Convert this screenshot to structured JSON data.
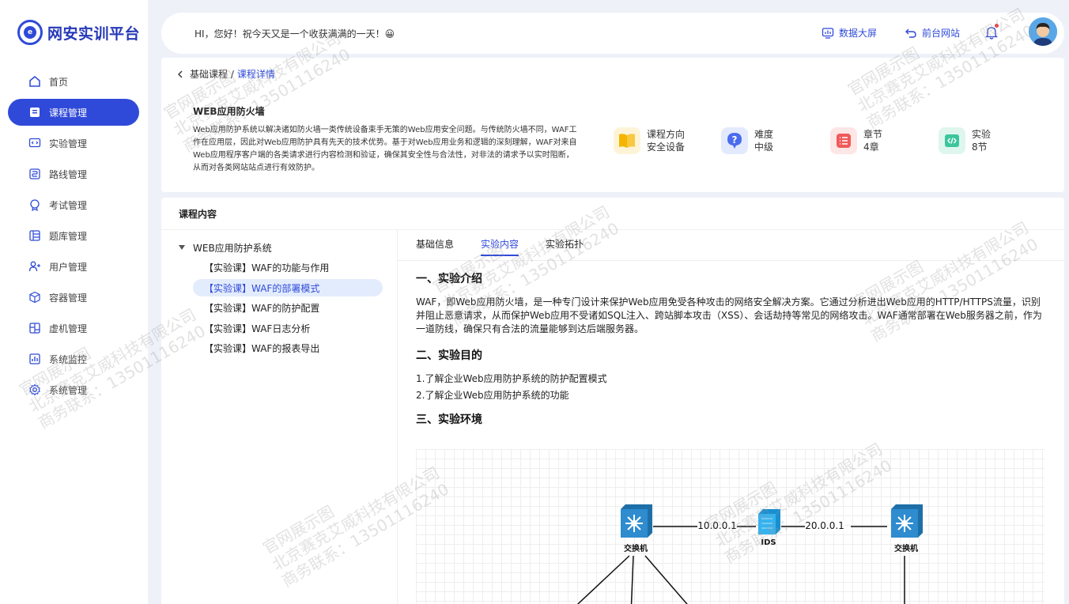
{
  "app": {
    "logo_text": "网安实训平台",
    "logo_glyph": "e"
  },
  "sidebar": {
    "items": [
      {
        "label": "首页",
        "icon": "home-icon"
      },
      {
        "label": "课程管理",
        "icon": "book-icon",
        "active": true
      },
      {
        "label": "实验管理",
        "icon": "code-icon"
      },
      {
        "label": "路线管理",
        "icon": "route-icon"
      },
      {
        "label": "考试管理",
        "icon": "exam-icon"
      },
      {
        "label": "题库管理",
        "icon": "question-bank-icon"
      },
      {
        "label": "用户管理",
        "icon": "users-icon"
      },
      {
        "label": "容器管理",
        "icon": "cube-icon"
      },
      {
        "label": "虚机管理",
        "icon": "vm-icon"
      },
      {
        "label": "系统监控",
        "icon": "monitor-icon"
      },
      {
        "label": "系统管理",
        "icon": "gear-icon"
      }
    ]
  },
  "topbar": {
    "greeting": "HI，您好！祝今天又是一个收获满满的一天！😀",
    "data_screen": "数据大屏",
    "front_site": "前台网站"
  },
  "breadcrumb": {
    "parent": "基础课程 /",
    "current": "课程详情"
  },
  "course": {
    "title": "WEB应用防火墙",
    "description": "Web应用防护系统以解决诸如防火墙一类传统设备束手无策的Web应用安全问题。与传统防火墙不同，WAF工作在应用层，因此对Web应用防护具有先天的技术优势。基于对Web应用业务和逻辑的深刻理解，WAF对来自Web应用程序客户端的各类请求进行内容检测和验证，确保其安全性与合法性，对非法的请求予以实时阻断，从而对各类网站站点进行有效防护。",
    "meta": [
      {
        "label": "课程方向",
        "value": "安全设备",
        "icon": "book-open-icon",
        "color": "#f5b400",
        "bg": "#fdf4d8"
      },
      {
        "label": "难度",
        "value": "中级",
        "icon": "question-icon",
        "color": "#4a6cf0",
        "bg": "#e4eafd"
      },
      {
        "label": "章节",
        "value": "4章",
        "icon": "list-icon",
        "color": "#f05a5a",
        "bg": "#fde6e6"
      },
      {
        "label": "实验",
        "value": "8节",
        "icon": "code-icon",
        "color": "#3cc59a",
        "bg": "#def6ee"
      }
    ]
  },
  "content": {
    "section_title": "课程内容",
    "tree": {
      "root": "WEB应用防护系统",
      "items": [
        {
          "label": "【实验课】WAF的功能与作用"
        },
        {
          "label": "【实验课】WAF的部署模式",
          "selected": true
        },
        {
          "label": "【实验课】WAF的防护配置"
        },
        {
          "label": "【实验课】WAF日志分析"
        },
        {
          "label": "【实验课】WAF的报表导出"
        }
      ]
    },
    "tabs": [
      {
        "label": "基础信息"
      },
      {
        "label": "实验内容",
        "active": true
      },
      {
        "label": "实验拓扑"
      }
    ],
    "doc": {
      "h1": "一、实验介绍",
      "intro": "WAF，即Web应用防火墙，是一种专门设计来保护Web应用免受各种攻击的网络安全解决方案。它通过分析进出Web应用的HTTP/HTTPS流量，识别并阻止恶意请求，从而保护Web应用不受诸如SQL注入、跨站脚本攻击（XSS）、会话劫持等常见的网络攻击。WAF通常部署在Web服务器之前，作为一道防线，确保只有合法的流量能够到达后端服务器。",
      "h2": "二、实验目的",
      "goals": [
        "1.了解企业Web应用防护系统的防护配置模式",
        "2.了解企业Web应用防护系统的功能"
      ],
      "h3": "三、实验环境"
    },
    "topology": {
      "switch_left": "交换机",
      "switch_right": "交换机",
      "ids": "IDS",
      "link_left": "10.0.0.1",
      "link_right": "20.0.0.1"
    }
  },
  "watermark": {
    "line1": "官网展示图",
    "line2": "北京赛克艾威科技有限公司",
    "line3": "商务联系：13501116240"
  }
}
